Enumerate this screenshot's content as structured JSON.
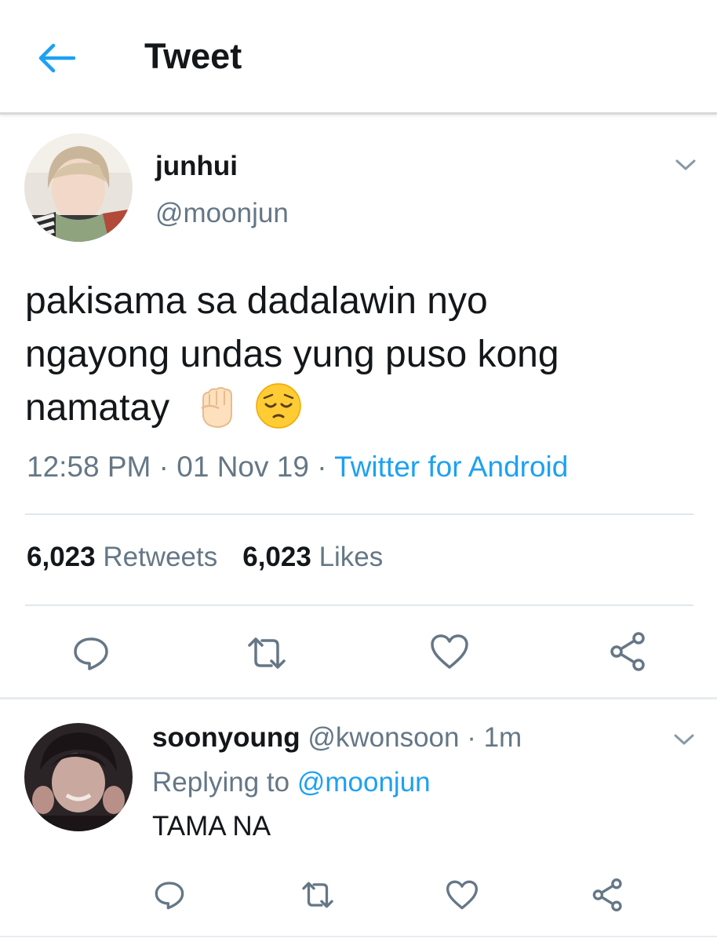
{
  "header": {
    "title": "Tweet",
    "back_icon": "arrow-left-icon",
    "accent": "#1da1f2"
  },
  "tweet": {
    "display_name": "junhui",
    "handle": "@moonjun",
    "lines": [
      "pakisama sa dadalawin nyo",
      "ngayong undas yung puso kong",
      "namatay"
    ],
    "emojis": [
      "raised-fist-emoji",
      "pensive-face-emoji"
    ],
    "time": "12:58 PM",
    "date": "01 Nov 19",
    "source": "Twitter for Android",
    "retweets_count": "6,023",
    "retweets_label": "Retweets",
    "likes_count": "6,023",
    "likes_label": "Likes"
  },
  "reply": {
    "display_name": "soonyoung",
    "handle": "@kwonsoon",
    "time": "1m",
    "replying_prefix": "Replying to",
    "replying_handle": "@moonjun",
    "text": "TAMA NA"
  },
  "icons": [
    "reply-icon",
    "retweet-icon",
    "like-icon",
    "share-icon",
    "chevron-down-icon"
  ],
  "colors": {
    "text": "#14171a",
    "secondary": "#657786",
    "link": "#1da1f2",
    "divider": "#e1e8ed"
  }
}
